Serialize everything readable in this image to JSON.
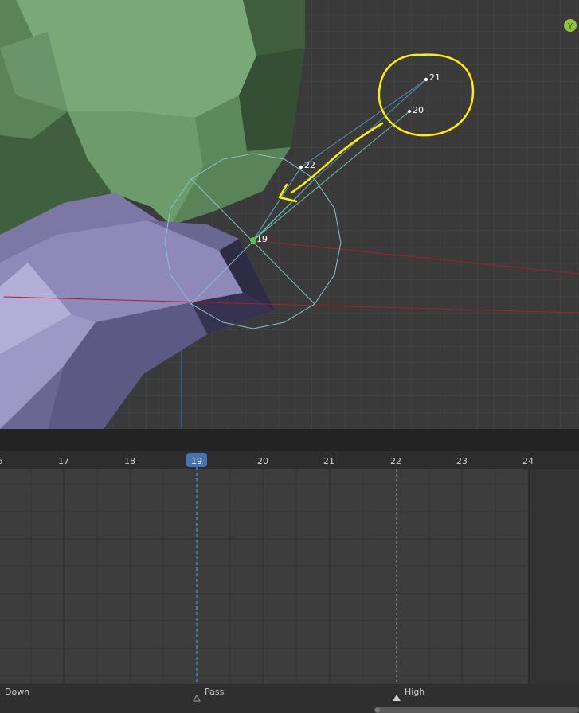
{
  "viewport": {
    "axis_gizmo_label": "Y",
    "vertex_labels": [
      "21",
      "20",
      "22",
      "19"
    ],
    "colors": {
      "background": "#3a3a3a",
      "grid": "#454545",
      "green_mesh": "#6f9a6c",
      "purple_mesh": "#7e7aa8",
      "bone_wire": "#7fc5c9",
      "annotation": "#ffee00",
      "red_axis": "#b0202a"
    }
  },
  "timeline": {
    "ticks": [
      "6",
      "17",
      "18",
      "19",
      "20",
      "21",
      "22",
      "23",
      "24"
    ],
    "current_frame": "19",
    "markers": [
      {
        "label": "Down"
      },
      {
        "label": "Pass"
      },
      {
        "label": "High"
      }
    ],
    "colors": {
      "background": "#3d3d3d",
      "header": "#2d2d2d",
      "current_frame": "#4772b3",
      "out_of_range": "#333333"
    }
  }
}
